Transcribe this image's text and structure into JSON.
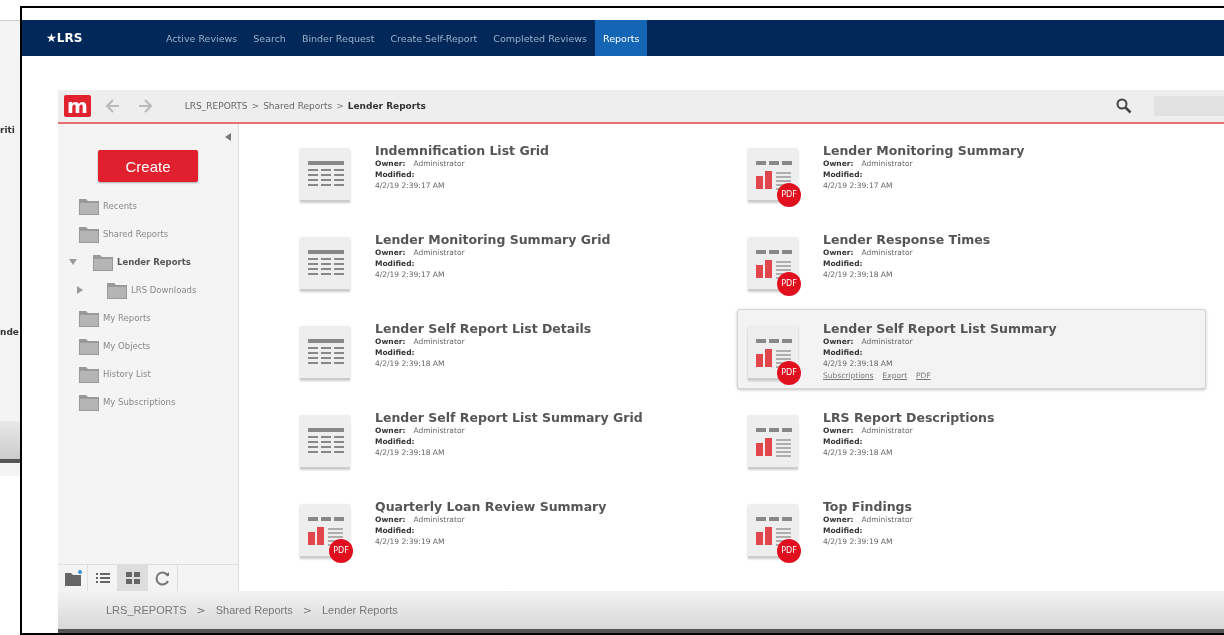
{
  "background_window": {
    "texts": [
      "riti",
      "nde"
    ]
  },
  "nav": {
    "brand": "★LRS",
    "tabs": [
      {
        "label": "Active Reviews",
        "selected": false
      },
      {
        "label": "Search",
        "selected": false
      },
      {
        "label": "Binder Request",
        "selected": false
      },
      {
        "label": "Create Self-Report",
        "selected": false
      },
      {
        "label": "Completed Reviews",
        "selected": false
      },
      {
        "label": "Reports",
        "selected": true
      }
    ]
  },
  "toolbar": {
    "logo": "m",
    "breadcrumb": [
      {
        "label": "LRS_REPORTS",
        "current": false
      },
      {
        "label": "Shared Reports",
        "current": false
      },
      {
        "label": "Lender Reports",
        "current": true
      }
    ],
    "separator": ">"
  },
  "sidebar": {
    "create_label": "Create",
    "items": [
      {
        "label": "Recents",
        "selected": false
      },
      {
        "label": "Shared Reports",
        "selected": false,
        "children": [
          {
            "label": "Lender Reports",
            "selected": true,
            "expanded": true,
            "children": [
              {
                "label": "LRS Downloads",
                "selected": false,
                "expanded": false
              }
            ]
          }
        ]
      },
      {
        "label": "My Reports",
        "selected": false
      },
      {
        "label": "My Objects",
        "selected": false
      },
      {
        "label": "History List",
        "selected": false
      },
      {
        "label": "My Subscriptions",
        "selected": false
      }
    ],
    "view_buttons": [
      {
        "kind": "folder",
        "selected": false
      },
      {
        "kind": "list",
        "selected": false
      },
      {
        "kind": "grid",
        "selected": true
      },
      {
        "kind": "refresh",
        "selected": false
      }
    ]
  },
  "reports": [
    {
      "title": "Indemnification List Grid",
      "kind": "grid",
      "owner_label": "Owner:",
      "owner": "Administrator",
      "modified_label": "Modified:",
      "modified": "4/2/19 2:39:17 AM",
      "selected": false
    },
    {
      "title": "Lender Monitoring Summary",
      "kind": "pdf",
      "badge": "PDF",
      "owner_label": "Owner:",
      "owner": "Administrator",
      "modified_label": "Modified:",
      "modified": "4/2/19 2:39:17 AM",
      "selected": false
    },
    {
      "title": "Lender Monitoring Summary Grid",
      "kind": "grid",
      "owner_label": "Owner:",
      "owner": "Administrator",
      "modified_label": "Modified:",
      "modified": "4/2/19 2:39:17 AM",
      "selected": false
    },
    {
      "title": "Lender Response Times",
      "kind": "pdf",
      "badge": "PDF",
      "owner_label": "Owner:",
      "owner": "Administrator",
      "modified_label": "Modified:",
      "modified": "4/2/19 2:39:18 AM",
      "selected": false
    },
    {
      "title": "Lender Self Report List Details",
      "kind": "grid",
      "owner_label": "Owner:",
      "owner": "Administrator",
      "modified_label": "Modified:",
      "modified": "4/2/19 2:39:18 AM",
      "selected": false
    },
    {
      "title": "Lender Self Report List Summary",
      "kind": "pdf",
      "badge": "PDF",
      "owner_label": "Owner:",
      "owner": "Administrator",
      "modified_label": "Modified:",
      "modified": "4/2/19 2:39:18 AM",
      "selected": true,
      "links": [
        "Subscriptions",
        "Export",
        "PDF"
      ]
    },
    {
      "title": "Lender Self Report List Summary Grid",
      "kind": "grid",
      "owner_label": "Owner:",
      "owner": "Administrator",
      "modified_label": "Modified:",
      "modified": "4/2/19 2:39:18 AM",
      "selected": false
    },
    {
      "title": "LRS Report Descriptions",
      "kind": "chart",
      "owner_label": "Owner:",
      "owner": "Administrator",
      "modified_label": "Modified:",
      "modified": "4/2/19 2:39:18 AM",
      "selected": false
    },
    {
      "title": "Quarterly Loan Review Summary",
      "kind": "pdf",
      "badge": "PDF",
      "owner_label": "Owner:",
      "owner": "Administrator",
      "modified_label": "Modified:",
      "modified": "4/2/19 2:39:19 AM",
      "selected": false
    },
    {
      "title": "Top Findings",
      "kind": "pdf",
      "badge": "PDF",
      "owner_label": "Owner:",
      "owner": "Administrator",
      "modified_label": "Modified:",
      "modified": "4/2/19 2:39:19 AM",
      "selected": false
    }
  ],
  "status_bar": {
    "breadcrumb": [
      "LRS_REPORTS",
      "Shared Reports",
      "Lender Reports"
    ],
    "separator": ">"
  }
}
